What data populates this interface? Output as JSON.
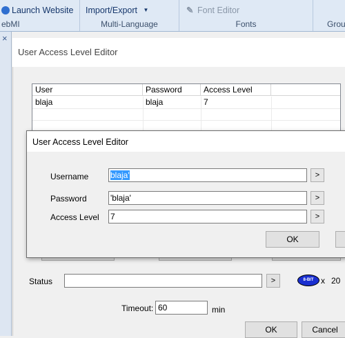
{
  "ribbon": {
    "launch_website": "Launch Website",
    "import_export": "Import/Export",
    "font_editor": "Font Editor",
    "group_webmi": "ebMI",
    "group_multilanguage": "Multi-Language",
    "group_fonts": "Fonts",
    "group_grou": "Grou"
  },
  "bg_window": {
    "title": "User Access Level Editor",
    "table": {
      "columns": [
        "User",
        "Password",
        "Access Level"
      ],
      "rows": [
        [
          "blaja",
          "blaja",
          "7"
        ]
      ]
    },
    "status_label": "Status",
    "status_value": "",
    "status_more": ">",
    "badge_text": "8-BIT",
    "multiplier": "x",
    "multiplier_value": "20",
    "timeout_label": "Timeout:",
    "timeout_value": "60",
    "timeout_unit": "min",
    "ok": "OK",
    "cancel": "Cancel"
  },
  "dialog": {
    "title": "User Access Level Editor",
    "username_label": "Username",
    "username_value": "blaja'",
    "password_label": "Password",
    "password_value": "'blaja'",
    "access_label": "Access Level",
    "access_value": "7",
    "more": ">",
    "ok": "OK"
  },
  "left_strip": {
    "close": "×"
  }
}
